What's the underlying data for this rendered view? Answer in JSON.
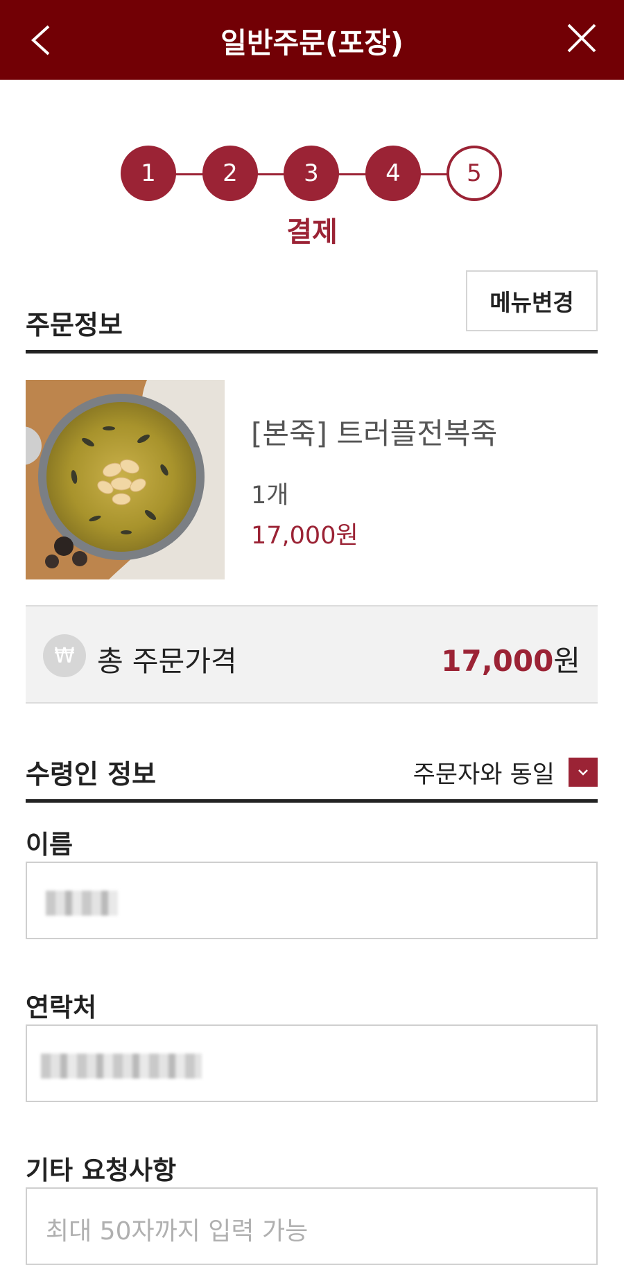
{
  "header": {
    "title": "일반주문(포장)",
    "back_icon": "back-arrow-icon",
    "close_icon": "close-icon",
    "background": "#720005"
  },
  "stepper": {
    "steps": [
      "1",
      "2",
      "3",
      "4",
      "5"
    ],
    "current_step": 5,
    "current_label": "결제",
    "accent": "#9b2335"
  },
  "order_info": {
    "title": "주문정보",
    "change_menu_label": "메뉴변경"
  },
  "product": {
    "name": "[본죽] 트러플전복죽",
    "quantity": "1개",
    "price": "17,000원"
  },
  "total": {
    "icon": "won-icon",
    "icon_symbol": "₩",
    "label": "총 주문가격",
    "amount_number": "17,000",
    "amount_unit": "원"
  },
  "recipient": {
    "title": "수령인 정보",
    "same_as_orderer_label": "주문자와 동일",
    "same_as_orderer_checked": true,
    "name_label": "이름",
    "contact_label": "연락처",
    "request_label": "기타 요청사항",
    "request_placeholder": "최대 50자까지 입력 가능"
  }
}
